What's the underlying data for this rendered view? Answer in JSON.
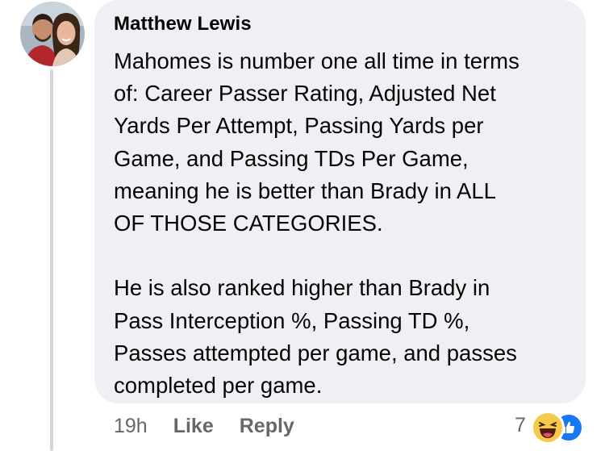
{
  "comment": {
    "author": "Matthew Lewis",
    "paragraphs": [
      [
        "Mahomes is number one all time in terms",
        "of: Career Passer Rating, Adjusted Net",
        "Yards Per Attempt, Passing Yards per",
        "Game, and Passing TDs Per Game,",
        "meaning he is better than Brady in ALL",
        "OF THOSE CATEGORIES."
      ],
      [
        "He is also ranked higher than Brady in",
        "Pass Interception %, Passing TD %,",
        "Passes attempted per game, and passes",
        "completed per game."
      ]
    ],
    "time": "19h",
    "like_label": "Like",
    "reply_label": "Reply",
    "reaction_count": "7",
    "reaction_icons": [
      "haha-icon",
      "like-icon"
    ],
    "colors": {
      "bubble": "#eef0f3",
      "secondary_text": "#65676b",
      "like_blue": "#1877f2",
      "haha_yellow": "#f7c94a"
    }
  }
}
